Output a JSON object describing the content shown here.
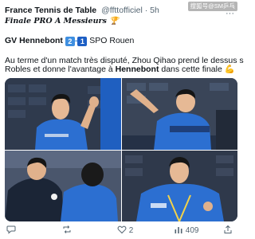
{
  "tweet": {
    "author": "France Tennis de Table",
    "handle": "@fftt­officiel",
    "separator": "·",
    "time": "5h",
    "watermark": "搜狐号@SM乒乓",
    "line1": "Finale PRO A Messieurs",
    "line1_emoji": "🏆",
    "match": {
      "team1": "GV Hennebont",
      "score1": "2",
      "score2": "1",
      "team2": "SPO Rouen"
    },
    "text_part1": "Au terme d'un match très disputé, Zhou Qihao prend le dessus sur Alvar",
    "text_part2a": "Robles et donne l'avantage à ",
    "text_part2b": "Hennebont",
    "text_part2c": " dans cette finale",
    "text_emoji": "💪",
    "colors": {
      "score_blue": "#3f8fe0",
      "score_dark": "#1d5fc4",
      "muted": "#536471",
      "jersey_blue": "#2c6fd1"
    }
  },
  "actions": {
    "reply_count": "",
    "retweet_count": "",
    "like_count": "2",
    "views_count": "409"
  }
}
